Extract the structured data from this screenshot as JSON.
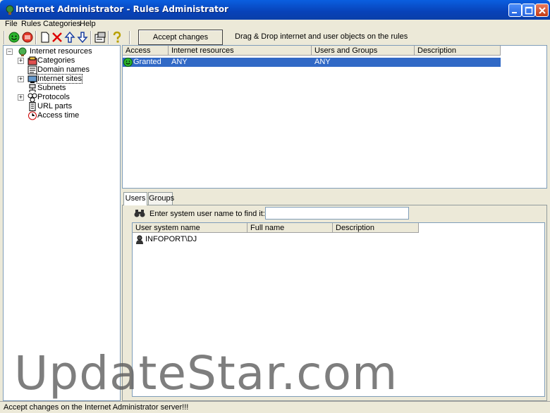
{
  "window": {
    "title": "Internet Administrator - Rules Administrator"
  },
  "menu": [
    "File",
    "Rules",
    "Categories",
    "Help"
  ],
  "toolbar": {
    "tools": [
      "allow-icon",
      "deny-icon",
      "new-icon",
      "delete-icon",
      "move-up-icon",
      "move-down-icon",
      "properties-icon",
      "help-icon"
    ],
    "accept_label": "Accept changes",
    "hint": "Drag & Drop internet and user objects on the rules"
  },
  "tree": {
    "root": "Internet resources",
    "items": [
      "Categories",
      "Domain names",
      "Internet sites",
      "Subnets",
      "Protocols",
      "URL parts",
      "Access time"
    ]
  },
  "rules": {
    "columns": [
      "Access",
      "Internet resources",
      "Users and Groups",
      "Description"
    ],
    "rows": [
      {
        "access": "Granted",
        "resources": "ANY",
        "users": "ANY",
        "description": ""
      }
    ]
  },
  "tabs": [
    "Users",
    "Groups"
  ],
  "users_pane": {
    "find_label": "Enter system user name to find it:",
    "find_value": "",
    "columns": [
      "User system name",
      "Full name",
      "Description"
    ],
    "rows": [
      {
        "system_name": "INFOPORT\\DJ",
        "full_name": "",
        "description": ""
      }
    ]
  },
  "status": "Accept changes on the Internet Administrator server!!!",
  "watermark": "UpdateStar.com",
  "colors": {
    "title_bar": "#0842b8",
    "selection": "#3169c6",
    "granted": "#2db52d"
  }
}
